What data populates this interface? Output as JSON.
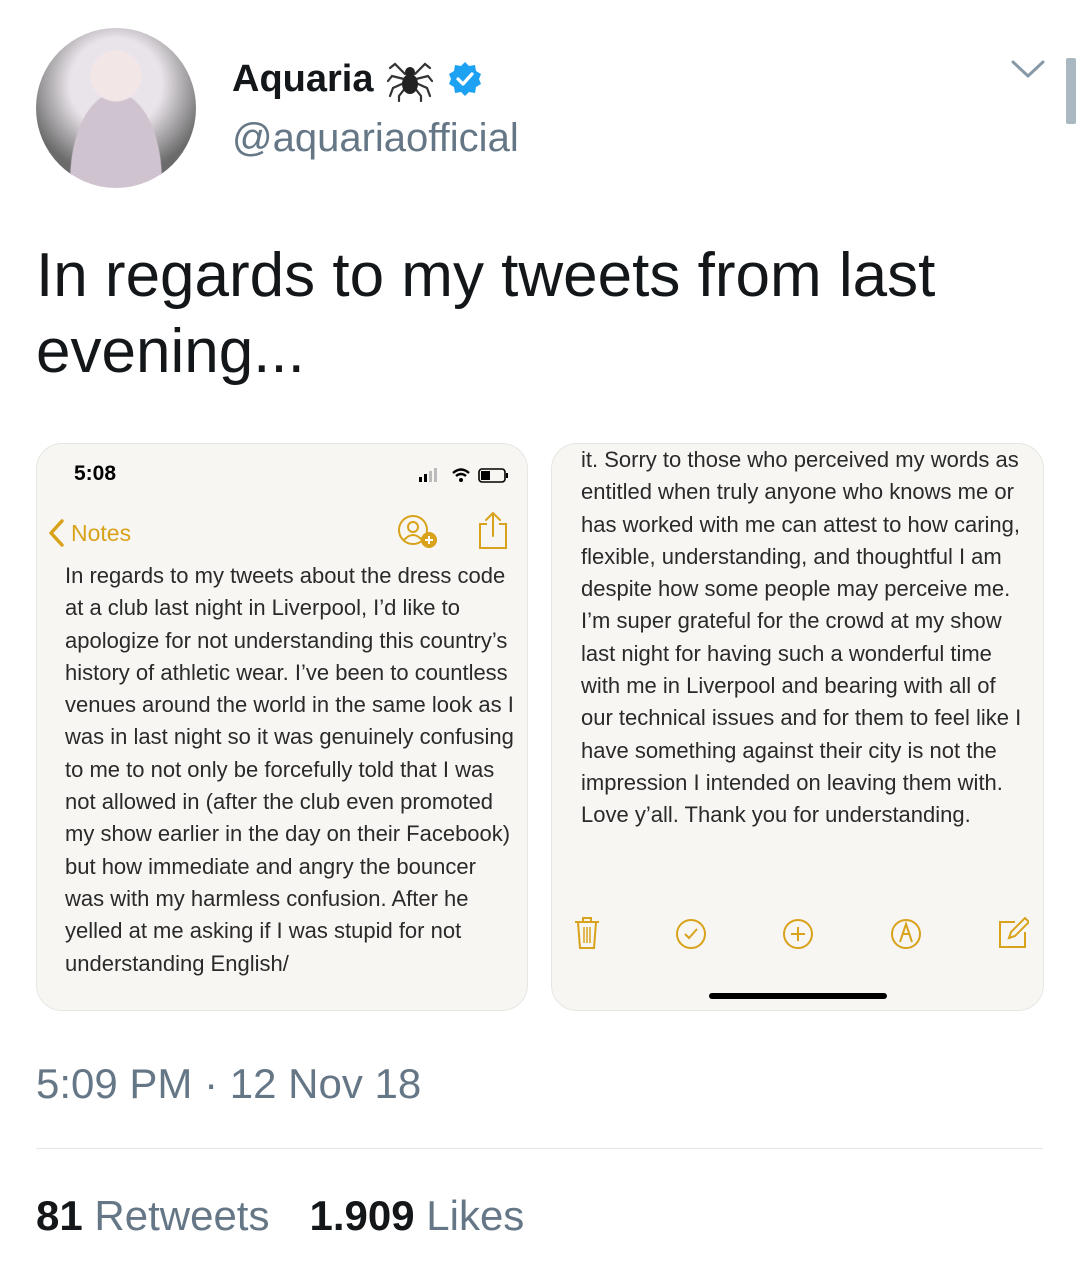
{
  "author": {
    "name": "Aquaria",
    "handle": "@aquariaofficial"
  },
  "tweet": {
    "text": "In regards to my tweets from last evening...",
    "timestamp": "5:09 PM · 12 Nov 18"
  },
  "stats": {
    "retweets_count": "81",
    "retweets_label": "Retweets",
    "likes_count": "1.909",
    "likes_label": "Likes"
  },
  "screenshot1": {
    "status_time": "5:08",
    "back_label": "Notes",
    "note_text": "In regards to my tweets about the dress code at a club last night in Liverpool, I’d like to apologize for not understanding this country’s history of athletic wear. I’ve been to countless venues around the world in the same look as I was in last night so it was genuinely confusing to me to not only be forcefully told that I was not allowed in (after the club even promoted my show earlier in the day on their Facebook) but how immediate and angry the bouncer was with my harmless confusion. After he yelled at me asking if I was stupid for not understanding English/"
  },
  "screenshot2": {
    "note_text": "it. Sorry to those who perceived my words as entitled when truly anyone who knows me or has worked with me can attest to how caring, flexible, understanding, and thoughtful I am despite how some people may perceive me. I’m super grateful for the crowd at my show last night for having such a wonderful time with me in Liverpool and bearing with all of our technical issues and for them to feel like I have something against their city is not the impression I intended on leaving them with. Love y’all. Thank you for understanding."
  },
  "colors": {
    "notes_accent": "#d9a21b",
    "verified_blue": "#1da1f2",
    "secondary_text": "#657786"
  },
  "icons": [
    "spider-icon",
    "verified-badge-icon",
    "chevron-down-icon",
    "back-chevron-icon",
    "add-person-icon",
    "share-icon",
    "trash-icon",
    "checklist-icon",
    "add-icon",
    "markup-icon",
    "compose-icon"
  ]
}
